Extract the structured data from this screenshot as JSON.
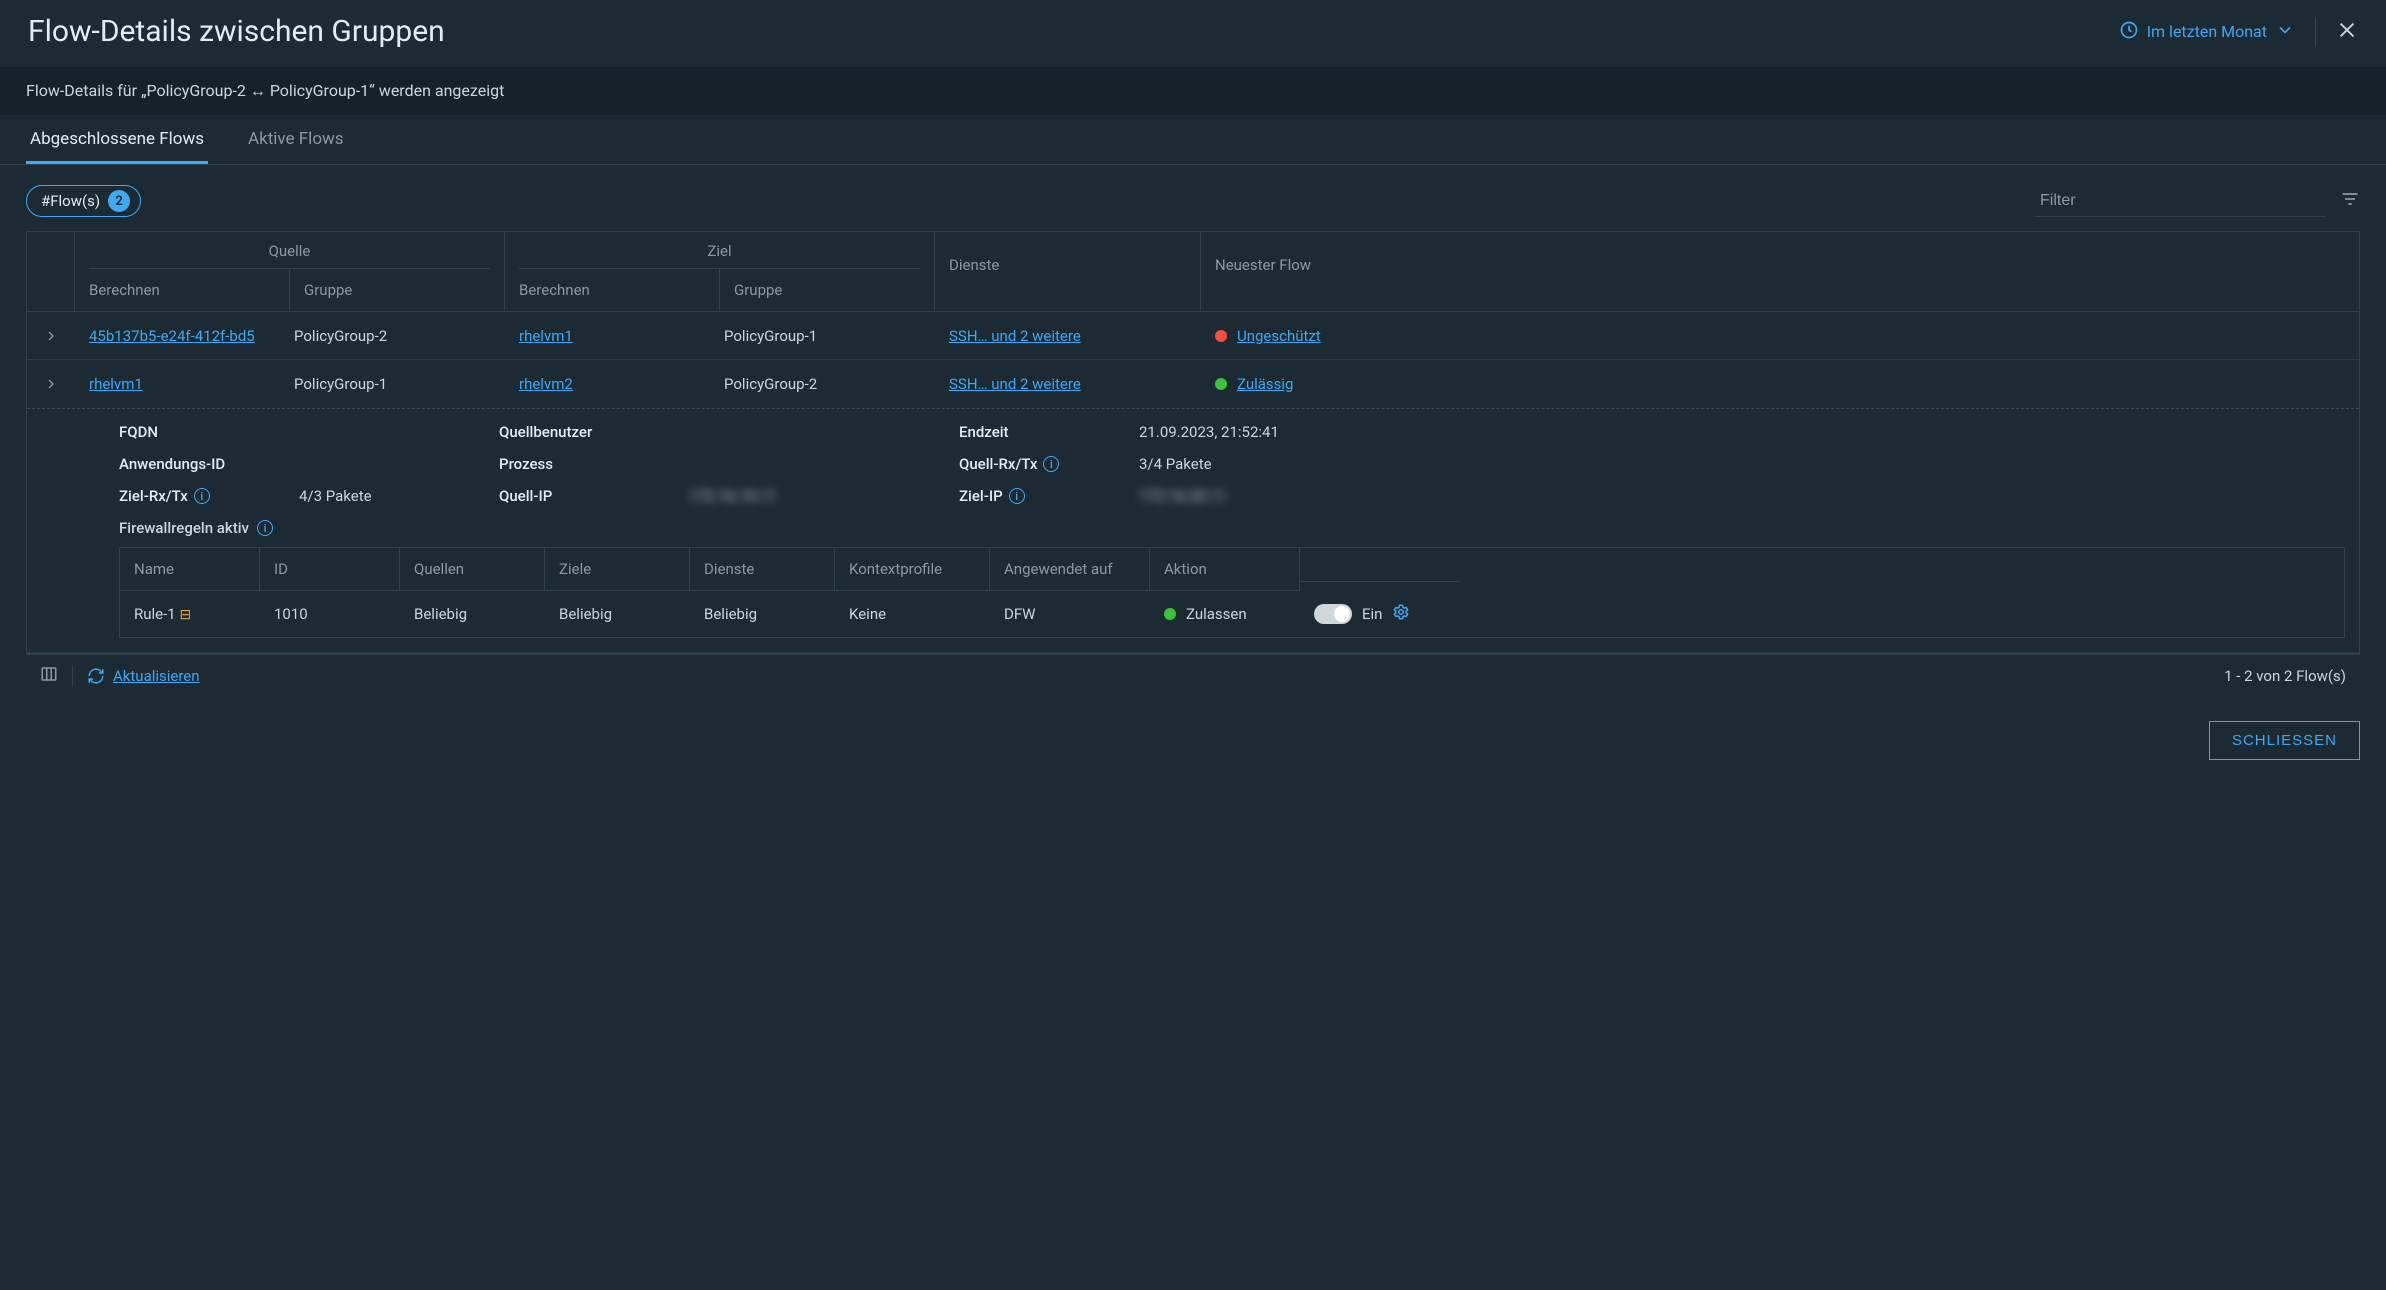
{
  "header": {
    "title": "Flow-Details zwischen Gruppen",
    "time_picker_label": "Im letzten Monat"
  },
  "subheader": "Flow-Details für „PolicyGroup-2 ↔ PolicyGroup-1“ werden angezeigt",
  "tabs": {
    "completed": "Abgeschlossene Flows",
    "active": "Aktive Flows"
  },
  "filter": {
    "pill_label": "#Flow(s)",
    "pill_count": "2",
    "placeholder": "Filter"
  },
  "columns": {
    "source_group": "Quelle",
    "target_group": "Ziel",
    "compute": "Berechnen",
    "group": "Gruppe",
    "services": "Dienste",
    "latest": "Neuester Flow"
  },
  "rows": [
    {
      "src_compute": "45b137b5-e24f-412f-bd5",
      "src_group": "PolicyGroup-2",
      "tgt_compute": "rhelvm1",
      "tgt_group": "PolicyGroup-1",
      "services": "SSH… und 2 weitere",
      "status_color": "red",
      "status_text": "Ungeschützt"
    },
    {
      "src_compute": "rhelvm1",
      "src_group": "PolicyGroup-1",
      "tgt_compute": "rhelvm2",
      "tgt_group": "PolicyGroup-2",
      "services": "SSH… und 2 weitere",
      "status_color": "green",
      "status_text": "Zulässig"
    }
  ],
  "details": {
    "labels": {
      "fqdn": "FQDN",
      "src_user": "Quellbenutzer",
      "end_time": "Endzeit",
      "app_id": "Anwendungs-ID",
      "process": "Prozess",
      "src_rxtx": "Quell-Rx/Tx",
      "dst_rxtx": "Ziel-Rx/Tx",
      "src_ip": "Quell-IP",
      "dst_ip": "Ziel-IP",
      "fw_active": "Firewallregeln aktiv"
    },
    "values": {
      "end_time": "21.09.2023, 21:52:41",
      "src_rxtx": "3/4 Pakete",
      "dst_rxtx": "4/3 Pakete",
      "src_ip": "172.16.10.11",
      "dst_ip": "172.16.20.11"
    },
    "fw_columns": {
      "name": "Name",
      "id": "ID",
      "sources": "Quellen",
      "targets": "Ziele",
      "services": "Dienste",
      "context": "Kontextprofile",
      "applied": "Angewendet auf",
      "action": "Aktion"
    },
    "fw_row": {
      "name": "Rule-1",
      "id": "1010",
      "sources": "Beliebig",
      "targets": "Beliebig",
      "services": "Beliebig",
      "context": "Keine",
      "applied": "DFW",
      "action": "Zulassen",
      "toggle_label": "Ein"
    }
  },
  "footer": {
    "refresh": "Aktualisieren",
    "range": "1 - 2 von 2 Flow(s)"
  },
  "actions": {
    "close": "SCHLIESSEN"
  }
}
